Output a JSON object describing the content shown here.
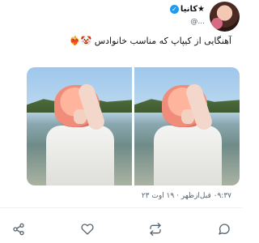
{
  "tweet": {
    "display_name": "★کانیا",
    "verified_mark": "✓",
    "handle": "@...",
    "text": "آهنگایی از کیپاپ که مناسب خانوادس 🤡❤️‍🔥",
    "timestamp": "۰۹:۳۷ قبل‌ازظهر · ۱۹ اوت ۲۳"
  },
  "colors": {
    "accent": "#1d9bf0",
    "muted": "#536471"
  },
  "actions": [
    {
      "icon": "share-icon"
    },
    {
      "icon": "heart-icon"
    },
    {
      "icon": "retweet-icon"
    },
    {
      "icon": "reply-icon"
    }
  ]
}
